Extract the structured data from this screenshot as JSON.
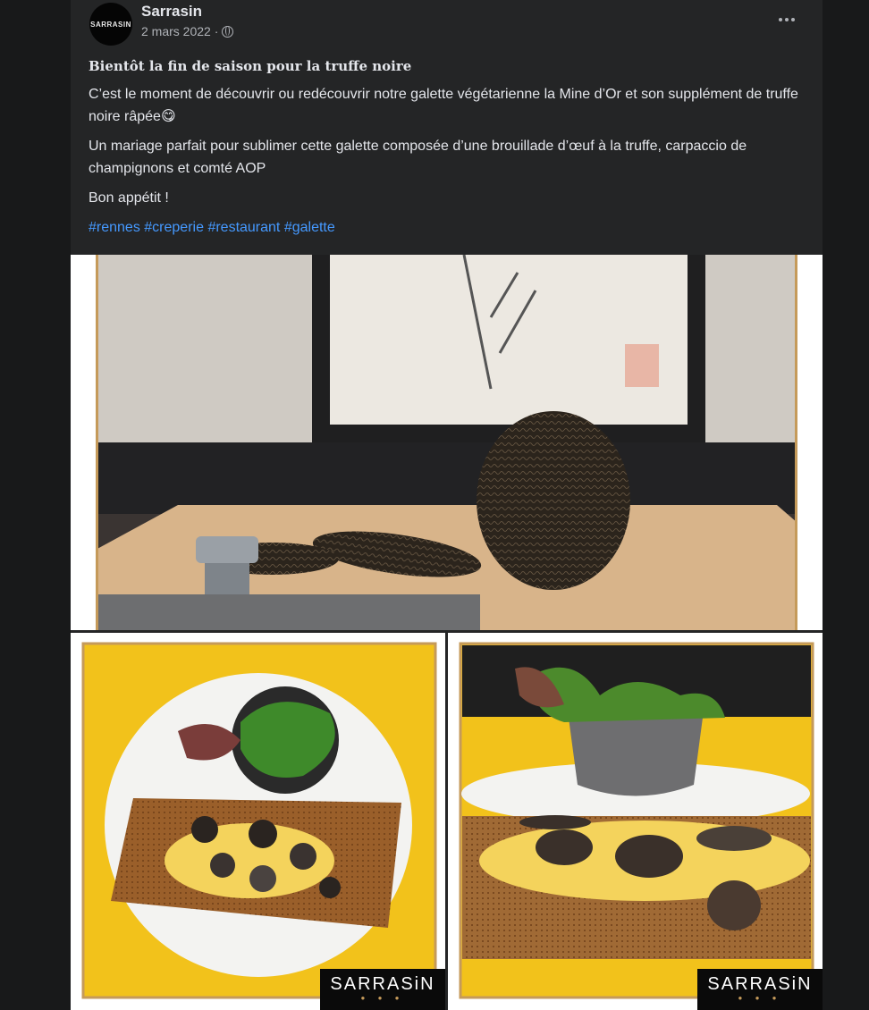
{
  "post": {
    "author": "Sarrasin",
    "avatar_text": "SARRASIN",
    "date": "2 mars 2022 ·",
    "title": "Bientôt la fin de saison pour la truffe noire",
    "paragraphs": [
      "C’est le moment de découvrir ou redécouvrir notre galette végétarienne la Mine d’Or et son supplément de truffe noire râpée😋",
      "Un mariage parfait pour sublimer cette galette composée d’une brouillade d’œuf à la truffe, carpaccio de champignons et comté AOP",
      "Bon appétit !"
    ],
    "hashtags": [
      "#rennes",
      "#creperie",
      "#restaurant",
      "#galette"
    ]
  },
  "images": {
    "watermark_text": "SARRASiN",
    "watermark_dots": "● ● ●"
  },
  "icons": {
    "more": "more-options-icon",
    "globe": "globe-icon"
  },
  "colors": {
    "background": "#18191a",
    "card": "#242526",
    "text": "#e4e6eb",
    "secondary_text": "#b0b3b8",
    "hashtag": "#4599ff",
    "gold": "#c59a5a",
    "yellow": "#f2c21b"
  }
}
